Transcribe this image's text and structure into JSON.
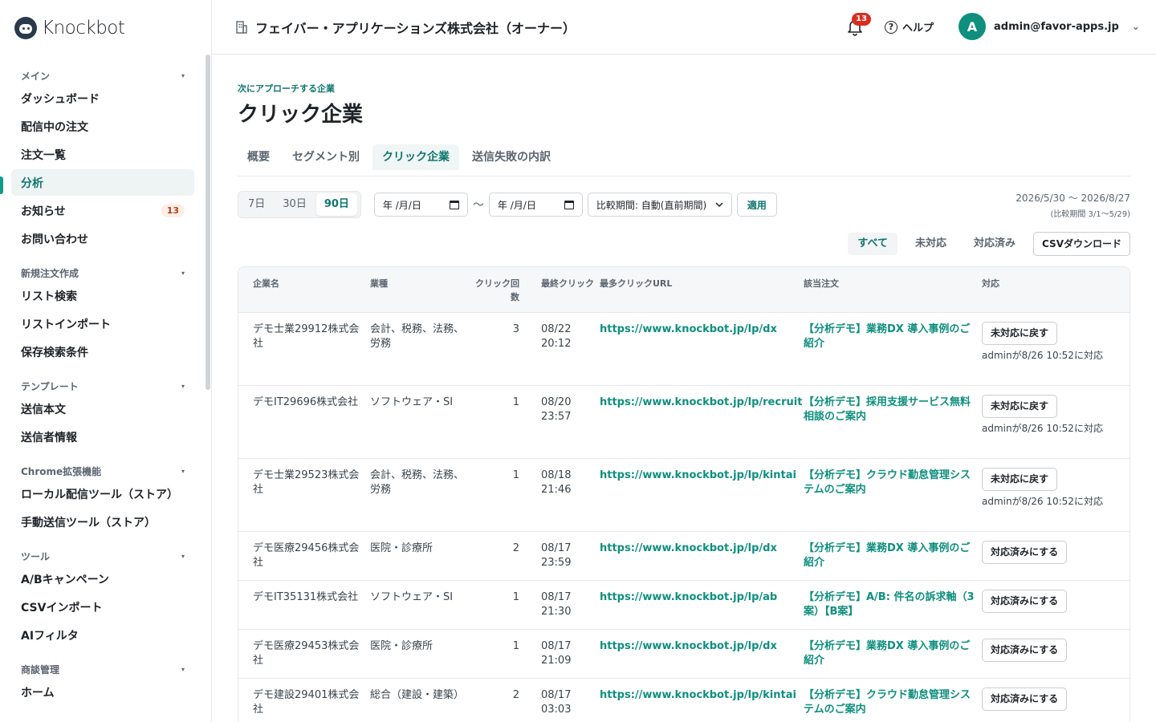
{
  "app": {
    "name": "Knockbot"
  },
  "sidebar": {
    "groups": [
      {
        "title": "メイン",
        "items": [
          {
            "label": "ダッシュボード"
          },
          {
            "label": "配信中の注文"
          },
          {
            "label": "注文一覧"
          },
          {
            "label": "分析",
            "active": true
          },
          {
            "label": "お知らせ",
            "badge": "13"
          },
          {
            "label": "お問い合わせ"
          }
        ]
      },
      {
        "title": "新規注文作成",
        "items": [
          {
            "label": "リスト検索"
          },
          {
            "label": "リストインポート"
          },
          {
            "label": "保存検索条件"
          }
        ]
      },
      {
        "title": "テンプレート",
        "items": [
          {
            "label": "送信本文"
          },
          {
            "label": "送信者情報"
          }
        ]
      },
      {
        "title": "Chrome拡張機能",
        "items": [
          {
            "label": "ローカル配信ツール（ストア）"
          },
          {
            "label": "手動送信ツール（ストア）"
          }
        ]
      },
      {
        "title": "ツール",
        "items": [
          {
            "label": "A/Bキャンペーン"
          },
          {
            "label": "CSVインポート"
          },
          {
            "label": "AIフィルタ"
          }
        ]
      },
      {
        "title": "商談管理",
        "items": [
          {
            "label": "ホーム"
          }
        ]
      }
    ]
  },
  "header": {
    "org": "フェイバー・アプリケーションズ株式会社（オーナー）",
    "notification_count": "13",
    "help": "ヘルプ",
    "avatar_initial": "A",
    "user_email": "admin@favor-apps.jp"
  },
  "page": {
    "eyebrow": "次にアプローチする企業",
    "title": "クリック企業",
    "tabs": [
      "概要",
      "セグメント別",
      "クリック企業",
      "送信失敗の内訳"
    ],
    "active_tab": 2
  },
  "filters": {
    "periods": [
      "7日",
      "30日",
      "90日"
    ],
    "active_period": 2,
    "date_from": "年 /月/日",
    "date_to": "年 /月/日",
    "range_sep": "〜",
    "compare": "比較期間: 自動(直前期間)",
    "apply": "適用",
    "range_main": "2026/5/30 〜 2026/8/27",
    "range_sub": "(比較期間 3/1〜5/29)"
  },
  "status_filters": [
    "すべて",
    "未対応",
    "対応済み"
  ],
  "csv_button": "CSVダウンロード",
  "table": {
    "headers": [
      "企業名",
      "業種",
      "クリック回数",
      "最終クリック",
      "最多クリックURL",
      "該当注文",
      "対応"
    ],
    "rows": [
      {
        "company": "デモ士業29912株式会社",
        "industry": "会計、税務、法務、労務",
        "clicks": "3",
        "last": "08/22 20:12",
        "url": "https://www.knockbot.jp/lp/dx",
        "order": "【分析デモ】業務DX 導入事例のご紹介",
        "action": "未対応に戻す",
        "note": "adminが8/26 10:52に対応"
      },
      {
        "company": "デモIT29696株式会社",
        "industry": "ソフトウェア・SI",
        "clicks": "1",
        "last": "08/20 23:57",
        "url": "https://www.knockbot.jp/lp/recruit",
        "order": "【分析デモ】採用支援サービス無料相談のご案内",
        "action": "未対応に戻す",
        "note": "adminが8/26 10:52に対応"
      },
      {
        "company": "デモ士業29523株式会社",
        "industry": "会計、税務、法務、労務",
        "clicks": "1",
        "last": "08/18 21:46",
        "url": "https://www.knockbot.jp/lp/kintai",
        "order": "【分析デモ】クラウド勤怠管理システムのご案内",
        "action": "未対応に戻す",
        "note": "adminが8/26 10:52に対応"
      },
      {
        "company": "デモ医療29456株式会社",
        "industry": "医院・診療所",
        "clicks": "2",
        "last": "08/17 23:59",
        "url": "https://www.knockbot.jp/lp/dx",
        "order": "【分析デモ】業務DX 導入事例のご紹介",
        "action": "対応済みにする",
        "note": ""
      },
      {
        "company": "デモIT35131株式会社",
        "industry": "ソフトウェア・SI",
        "clicks": "1",
        "last": "08/17 21:30",
        "url": "https://www.knockbot.jp/lp/ab",
        "order": "【分析デモ】A/B: 件名の訴求軸（3案）【B案】",
        "action": "対応済みにする",
        "note": ""
      },
      {
        "company": "デモ医療29453株式会社",
        "industry": "医院・診療所",
        "clicks": "1",
        "last": "08/17 21:09",
        "url": "https://www.knockbot.jp/lp/dx",
        "order": "【分析デモ】業務DX 導入事例のご紹介",
        "action": "対応済みにする",
        "note": ""
      },
      {
        "company": "デモ建設29401株式会社",
        "industry": "総合（建設・建築）",
        "clicks": "2",
        "last": "08/17 03:03",
        "url": "https://www.knockbot.jp/lp/kintai",
        "order": "【分析デモ】クラウド勤怠管理システムのご案内",
        "action": "対応済みにする",
        "note": ""
      }
    ]
  }
}
